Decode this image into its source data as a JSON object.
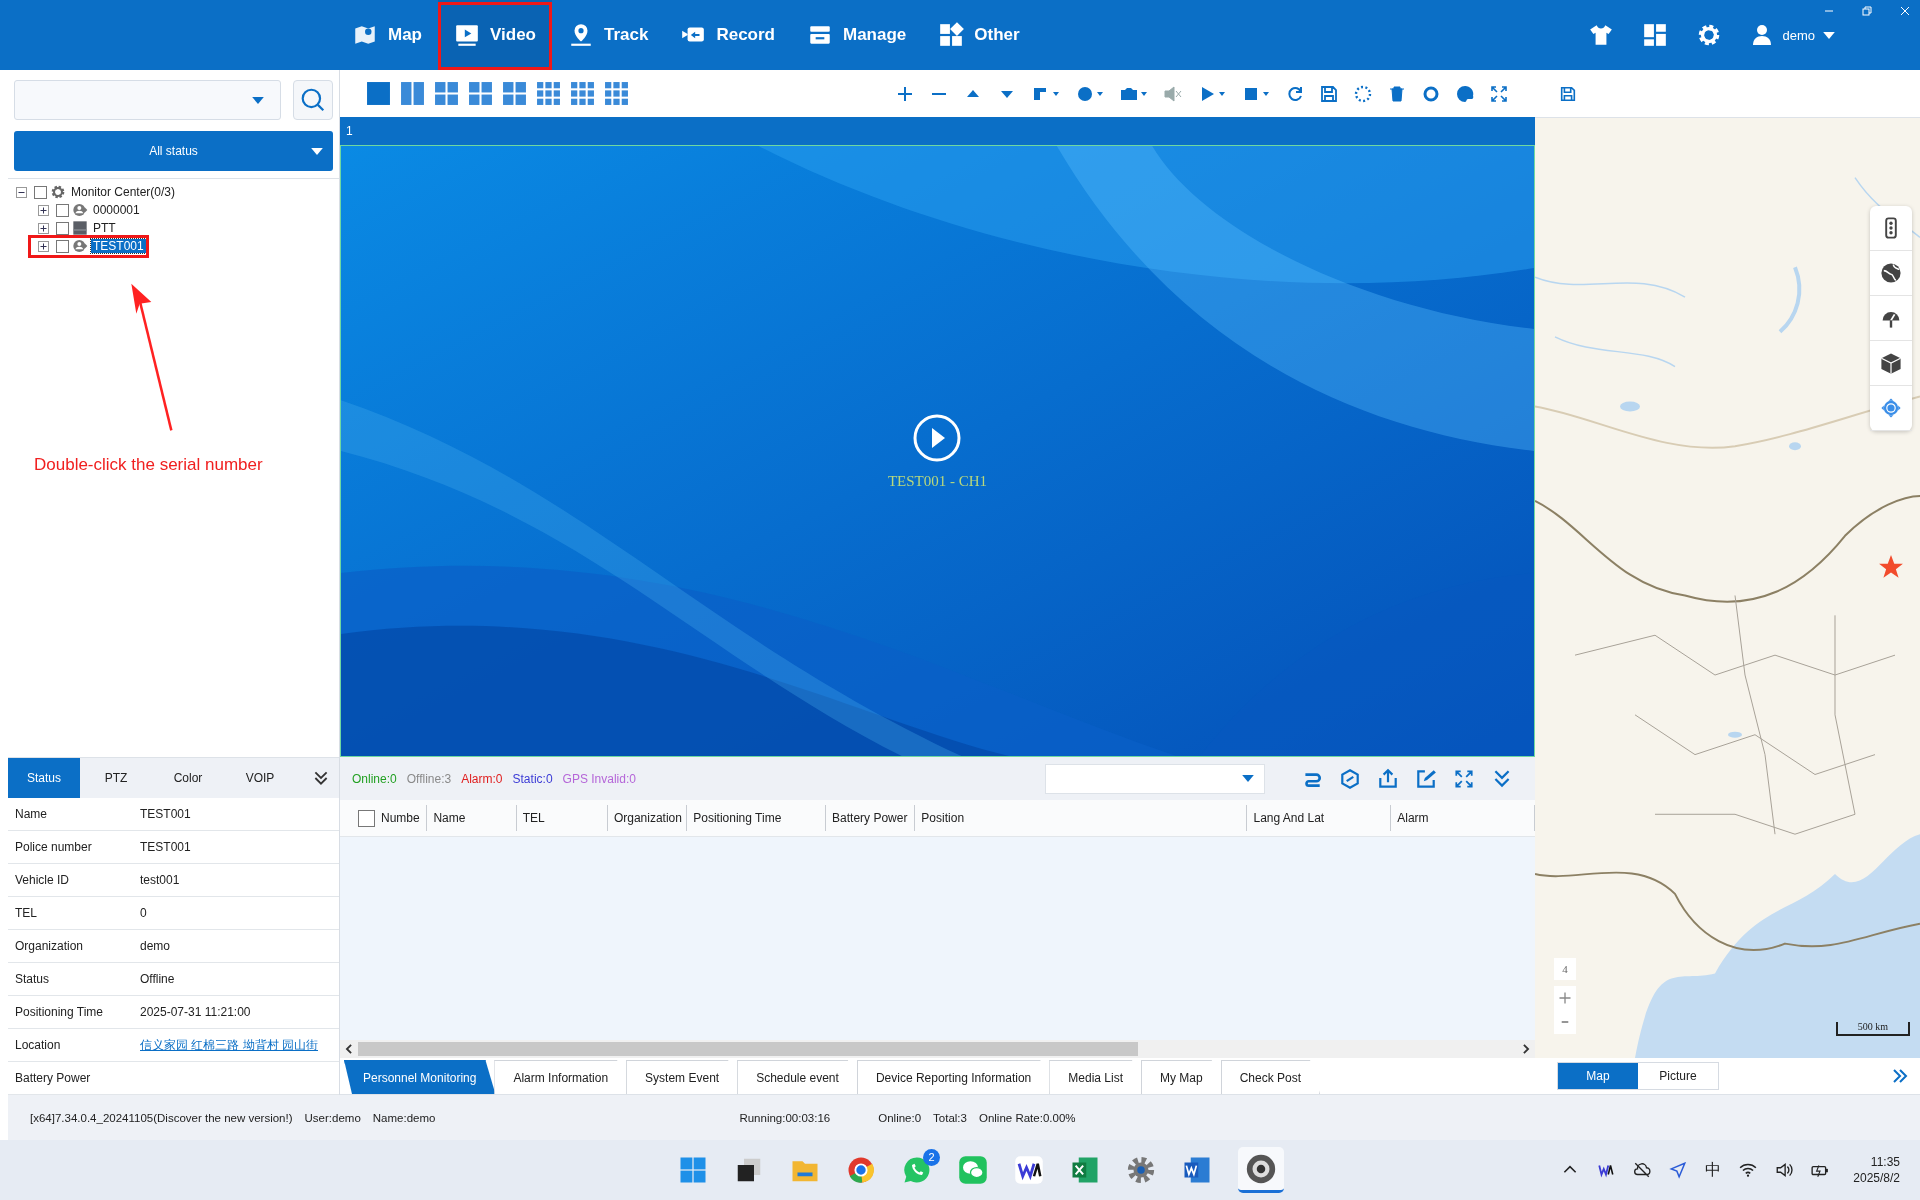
{
  "nav": [
    {
      "label": "Map",
      "selected": false,
      "highlighted": false,
      "kind": "map"
    },
    {
      "label": "Video",
      "selected": true,
      "highlighted": true,
      "kind": "video"
    },
    {
      "label": "Track",
      "selected": false,
      "highlighted": false,
      "kind": "track"
    },
    {
      "label": "Record",
      "selected": false,
      "highlighted": false,
      "kind": "record"
    },
    {
      "label": "Manage",
      "selected": false,
      "highlighted": false,
      "kind": "manage"
    },
    {
      "label": "Other",
      "selected": false,
      "highlighted": false,
      "kind": "other"
    }
  ],
  "user": "demo",
  "status_filter": "All status",
  "tree": {
    "label": "Monitor Center(0/3)",
    "expanded": true,
    "checked": false,
    "children": [
      {
        "label": "0000001",
        "kind": "person",
        "checked": false,
        "expanded": false,
        "selected": false,
        "highlighted": false
      },
      {
        "label": "PTT",
        "kind": "group",
        "checked": false,
        "expanded": false,
        "selected": false,
        "highlighted": false
      },
      {
        "label": "TEST001",
        "kind": "person",
        "checked": false,
        "expanded": false,
        "selected": true,
        "highlighted": true
      }
    ]
  },
  "annotation": "Double-click the serial number",
  "detail_tabs": [
    {
      "label": "Status",
      "selected": true
    },
    {
      "label": "PTZ",
      "selected": false
    },
    {
      "label": "Color",
      "selected": false
    },
    {
      "label": "VOIP",
      "selected": false
    }
  ],
  "details": [
    {
      "label": "Name",
      "value": "TEST001",
      "kind": "text"
    },
    {
      "label": "Police number",
      "value": "TEST001",
      "kind": "text"
    },
    {
      "label": "Vehicle ID",
      "value": "test001",
      "kind": "text"
    },
    {
      "label": "TEL",
      "value": "0",
      "kind": "text"
    },
    {
      "label": "Organization",
      "value": "demo",
      "kind": "text"
    },
    {
      "label": "Status",
      "value": "Offline",
      "kind": "text"
    },
    {
      "label": "Positioning Time",
      "value": "2025-07-31 11:21:00",
      "kind": "text"
    },
    {
      "label": "Location",
      "value": "信义家园 红棉三路 坳背村 园山街",
      "kind": "link"
    },
    {
      "label": "Battery Power"
    }
  ],
  "video": {
    "window_number": "1",
    "caption": "TEST001 - CH1"
  },
  "counts": [
    {
      "label": "Online:0",
      "color": "#22a022"
    },
    {
      "label": "Offline:3",
      "color": "#8a8a8a"
    },
    {
      "label": "Alarm:0",
      "color": "#e02020"
    },
    {
      "label": "Static:0",
      "color": "#3b3bd6"
    },
    {
      "label": "GPS Invalid:0",
      "color": "#b566d8"
    }
  ],
  "table": {
    "checked": false,
    "columns": [
      "Numbe",
      "Name",
      "TEL",
      "Organization",
      "Positioning Time",
      "Battery Power",
      "Position",
      "Lang And Lat",
      "Alarm"
    ]
  },
  "bottom_tabs": [
    {
      "label": "Personnel Monitoring",
      "selected": true
    },
    {
      "label": "Alarm Information",
      "selected": false
    },
    {
      "label": "System Event",
      "selected": false
    },
    {
      "label": "Schedule event",
      "selected": false
    },
    {
      "label": "Device Reporting Information",
      "selected": false
    },
    {
      "label": "Media List",
      "selected": false
    },
    {
      "label": "My Map",
      "selected": false
    },
    {
      "label": "Check Post",
      "selected": false
    }
  ],
  "map": {
    "zoom": "4",
    "scale": "500 km",
    "view_tabs": [
      {
        "label": "Map",
        "selected": true
      },
      {
        "label": "Picture",
        "selected": false
      }
    ]
  },
  "status_bar": {
    "version": "[x64]7.34.0.4_20241105(Discover the new version!)",
    "user": "User:demo",
    "name": "Name:demo",
    "running": "Running:00:03:16",
    "online": "Online:0",
    "total": "Total:3",
    "rate": "Online Rate:0.00%"
  },
  "taskbar": {
    "badge": "2",
    "ime": "中",
    "time": "11:35",
    "date": "2025/8/2"
  }
}
